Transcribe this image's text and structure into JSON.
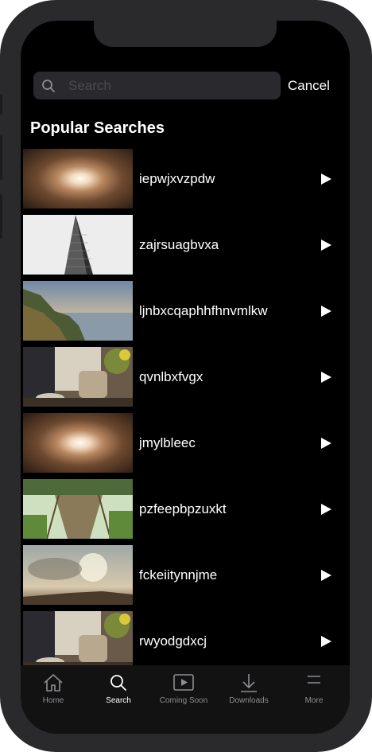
{
  "search": {
    "placeholder": "Search",
    "cancel_label": "Cancel"
  },
  "section_title": "Popular Searches",
  "results": [
    {
      "title": "iepwjxvzpdw",
      "thumbnail": "tunnel"
    },
    {
      "title": "zajrsuagbvxa",
      "thumbnail": "building"
    },
    {
      "title": "ljnbxcqaphhfhnvmlkw",
      "thumbnail": "coast"
    },
    {
      "title": "qvnlbxfvgx",
      "thumbnail": "teapot"
    },
    {
      "title": "jmylbleec",
      "thumbnail": "tunnel"
    },
    {
      "title": "pzfeepbpzuxkt",
      "thumbnail": "bridge"
    },
    {
      "title": "fckeiitynnjme",
      "thumbnail": "sky"
    },
    {
      "title": "rwyodgdxcj",
      "thumbnail": "teapot"
    }
  ],
  "tabs": [
    {
      "label": "Home",
      "icon": "home-icon",
      "active": false
    },
    {
      "label": "Search",
      "icon": "search-icon",
      "active": true
    },
    {
      "label": "Coming Soon",
      "icon": "play-square-icon",
      "active": false
    },
    {
      "label": "Downloads",
      "icon": "download-icon",
      "active": false
    },
    {
      "label": "More",
      "icon": "menu-icon",
      "active": false
    }
  ],
  "colors": {
    "background": "#000000",
    "search_field": "#2a2a2e",
    "tab_inactive": "#8e8e93",
    "tab_active": "#ffffff"
  }
}
